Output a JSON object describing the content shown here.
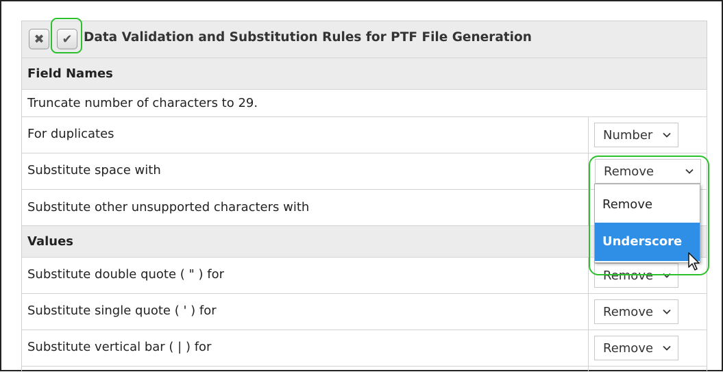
{
  "dialog": {
    "title": "Data Validation and Substitution Rules for PTF File Generation",
    "cancel_icon": "x-close-icon",
    "confirm_icon": "check-icon"
  },
  "sections": [
    {
      "heading": "Field Names",
      "truncate_text": "Truncate number of characters to 29.",
      "rules": [
        {
          "label": "For duplicates",
          "value": "Number"
        },
        {
          "label": "Substitute space with",
          "value": "Remove"
        },
        {
          "label": "Substitute other unsupported characters with",
          "value": ""
        }
      ]
    },
    {
      "heading": "Values",
      "rules": [
        {
          "label": "Substitute double quote ( \" ) for",
          "value": "Remove"
        },
        {
          "label": "Substitute single quote ( ' ) for",
          "value": "Remove"
        },
        {
          "label": "Substitute vertical bar ( | ) for",
          "value": "Remove"
        }
      ]
    }
  ],
  "open_dropdown": {
    "options": [
      "Remove",
      "Underscore"
    ],
    "highlighted": "Underscore"
  },
  "colors": {
    "highlight_outline": "#2cc02c",
    "selected_option": "#2f8ee6",
    "header_background": "#ececec"
  }
}
